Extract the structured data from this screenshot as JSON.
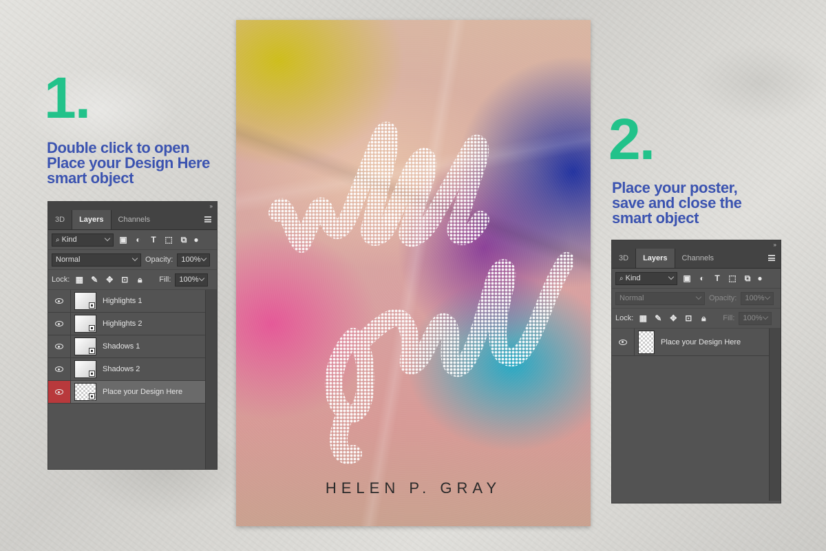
{
  "step1": {
    "number": "1.",
    "lines": [
      "Double click to open",
      "Place your Design Here",
      "smart object"
    ]
  },
  "step2": {
    "number": "2.",
    "lines": [
      "Place your poster,",
      "save and close the",
      "smart object"
    ]
  },
  "panel_left": {
    "collapse": "»",
    "tabs": [
      "3D",
      "Layers",
      "Channels"
    ],
    "active_tab": "Layers",
    "filter_kind": "Kind",
    "blend_mode": "Normal",
    "opacity_label": "Opacity:",
    "opacity_value": "100%",
    "lock_label": "Lock:",
    "fill_label": "Fill:",
    "fill_value": "100%",
    "layers": [
      {
        "name": "Highlights 1"
      },
      {
        "name": "Highlights 2"
      },
      {
        "name": "Shadows 1"
      },
      {
        "name": "Shadows 2"
      },
      {
        "name": "Place your Design Here"
      }
    ],
    "selected_layer": "Place your Design Here"
  },
  "panel_right": {
    "collapse": "»",
    "tabs": [
      "3D",
      "Layers",
      "Channels"
    ],
    "active_tab": "Layers",
    "filter_kind": "Kind",
    "blend_mode": "Normal",
    "opacity_label": "Opacity:",
    "opacity_value": "100%",
    "lock_label": "Lock:",
    "fill_label": "Fill:",
    "fill_value": "100%",
    "layers": [
      {
        "name": "Place your Design Here"
      }
    ]
  },
  "poster": {
    "script_text": "wild girls",
    "author": "HELEN P. GRAY"
  },
  "colors": {
    "step_number": "#22c28a",
    "step_text": "#3b53b0",
    "panel_bg": "#535353",
    "selected_eye": "#b8393c"
  }
}
